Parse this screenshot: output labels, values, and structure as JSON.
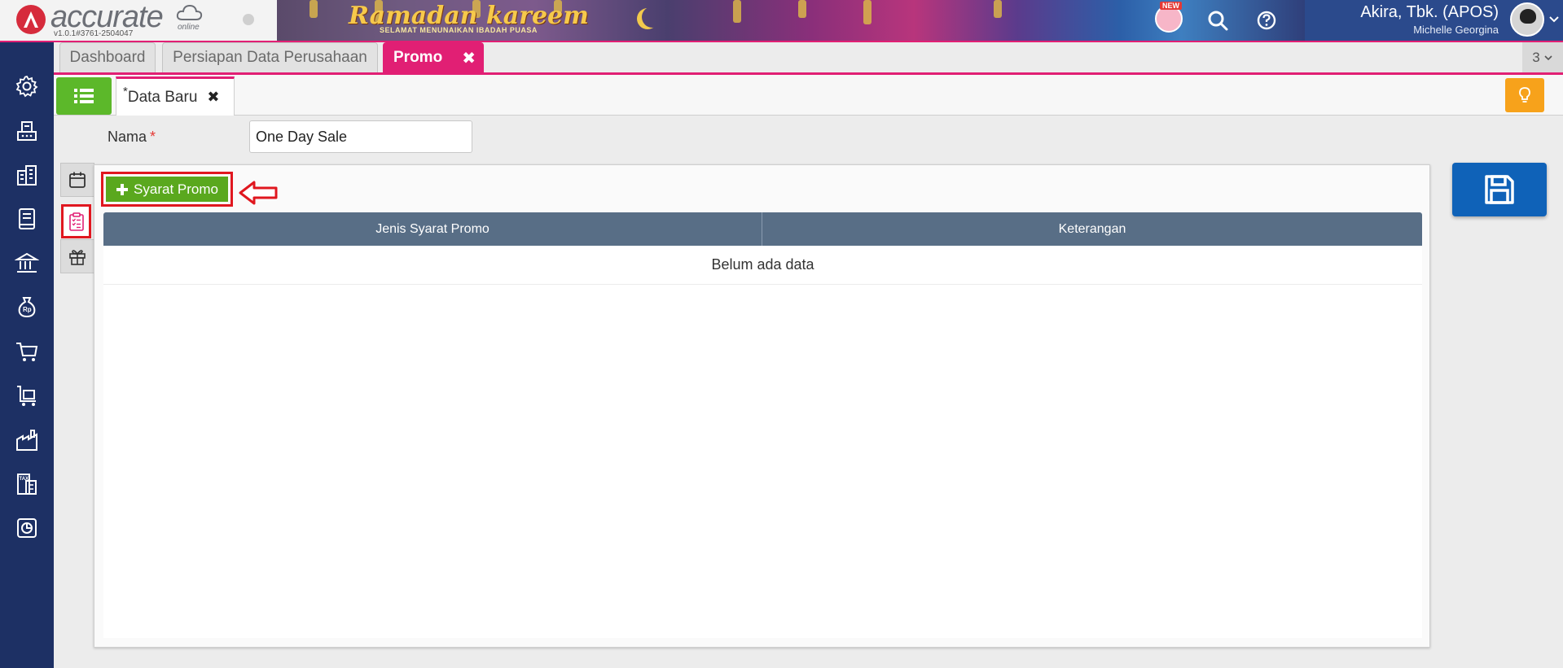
{
  "app": {
    "logo_text": "accurate",
    "logo_online": "online",
    "version": "v1.0.1#3761-2504047",
    "banner_title": "Ramadan kareem",
    "banner_subtitle": "SELAMAT MENUNAIKAN IBADAH PUASA",
    "new_badge": "NEW"
  },
  "user": {
    "company": "Akira, Tbk. (APOS)",
    "name": "Michelle Georgina"
  },
  "sidebar": {
    "items": [
      {
        "icon": "gear-icon"
      },
      {
        "icon": "fax-machine-icon"
      },
      {
        "icon": "buildings-icon"
      },
      {
        "icon": "ledger-book-icon"
      },
      {
        "icon": "bank-icon"
      },
      {
        "icon": "money-bag-icon"
      },
      {
        "icon": "shopping-cart-icon"
      },
      {
        "icon": "delivery-cart-icon"
      },
      {
        "icon": "factory-icon"
      },
      {
        "icon": "tax-document-icon"
      },
      {
        "icon": "report-chart-icon"
      }
    ]
  },
  "tabs": {
    "items": [
      {
        "label": "Dashboard"
      },
      {
        "label": "Persiapan Data Perusahaan"
      },
      {
        "label": "Promo"
      }
    ],
    "close_glyph": "✖",
    "overflow_count": "3"
  },
  "subtab": {
    "modified_marker": "*",
    "label": "Data Baru",
    "close_glyph": "✖"
  },
  "form": {
    "nama_label": "Nama",
    "required_marker": "*",
    "nama_value": "One Day Sale"
  },
  "promo_panel": {
    "add_button_label": "Syarat Promo",
    "columns": [
      "Jenis Syarat Promo",
      "Keterangan"
    ],
    "empty_text": "Belum ada data"
  },
  "colors": {
    "sidebar": "#1d3064",
    "accent_pink": "#e11f74",
    "green": "#5aa81e",
    "table_header": "#586e86",
    "save_blue": "#0f62b8",
    "highlight_red": "#e0171f"
  }
}
